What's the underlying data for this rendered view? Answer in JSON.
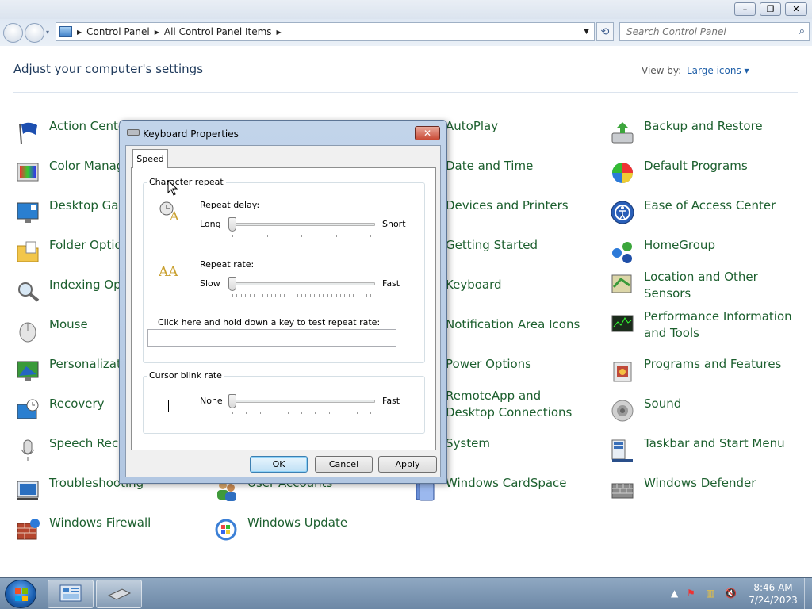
{
  "window": {
    "breadcrumbs": [
      "Control Panel",
      "All Control Panel Items"
    ],
    "search_placeholder": "Search Control Panel",
    "buttons": {
      "minimize": "–",
      "maximize": "❐",
      "close": "✕"
    }
  },
  "header": {
    "title": "Adjust your computer's settings",
    "view_by_label": "View by:",
    "view_by_value": "Large icons ▾"
  },
  "items": {
    "col1": [
      "Action Center",
      "Color Management",
      "Desktop Gadgets",
      "Folder Options",
      "Indexing Options",
      "Mouse",
      "Personalization",
      "Recovery",
      "Speech Recognition",
      "Troubleshooting",
      "Windows Firewall"
    ],
    "col2": [
      "User Accounts",
      "Windows Update"
    ],
    "col3": [
      "AutoPlay",
      "Date and Time",
      "Devices and Printers",
      "Getting Started",
      "Keyboard",
      "Notification Area Icons",
      "Power Options",
      "RemoteApp and Desktop Connections",
      "System",
      "Windows CardSpace"
    ],
    "col4": [
      "Backup and Restore",
      "Default Programs",
      "Ease of Access Center",
      "HomeGroup",
      "Location and Other Sensors",
      "Performance Information and Tools",
      "Programs and Features",
      "Sound",
      "Taskbar and Start Menu",
      "Windows Defender"
    ]
  },
  "dialog": {
    "title": "Keyboard Properties",
    "close_label": "✕",
    "tab": "Speed",
    "char_repeat_group": "Character repeat",
    "repeat_delay": {
      "label": "Repeat delay:",
      "min": "Long",
      "max": "Short",
      "value": 0
    },
    "repeat_rate": {
      "label": "Repeat rate:",
      "min": "Slow",
      "max": "Fast",
      "value": 0
    },
    "test_label": "Click here and hold down a key to test repeat rate:",
    "test_value": "",
    "cursor_group": "Cursor blink rate",
    "cursor_blink": {
      "min": "None",
      "max": "Fast",
      "value": 0
    },
    "ok": "OK",
    "cancel": "Cancel",
    "apply": "Apply"
  },
  "taskbar": {
    "time": "8:46 AM",
    "date": "7/24/2023"
  }
}
